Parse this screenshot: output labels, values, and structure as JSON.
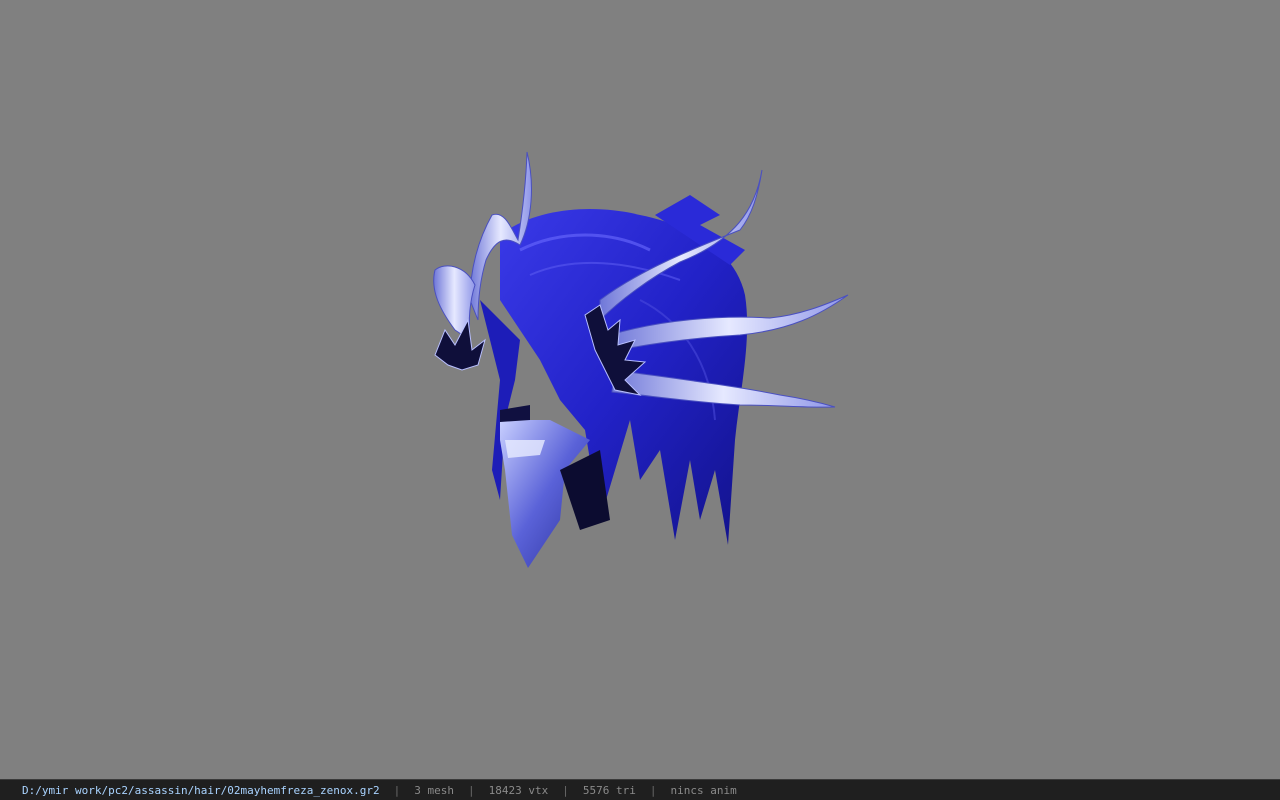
{
  "viewer": {
    "background_color": "#808080",
    "model_icon": "blue-hair-helmet-model"
  },
  "statusbar": {
    "file_path": "D:/ymir work/pc2/assassin/hair/02mayhemfreza_zenox.gr2",
    "separator": "|",
    "mesh_count": "3 mesh",
    "vertex_count": "18423 vtx",
    "triangle_count": "5576 tri",
    "anim_status": "nincs anim",
    "path_color": "#a9d3ff"
  }
}
